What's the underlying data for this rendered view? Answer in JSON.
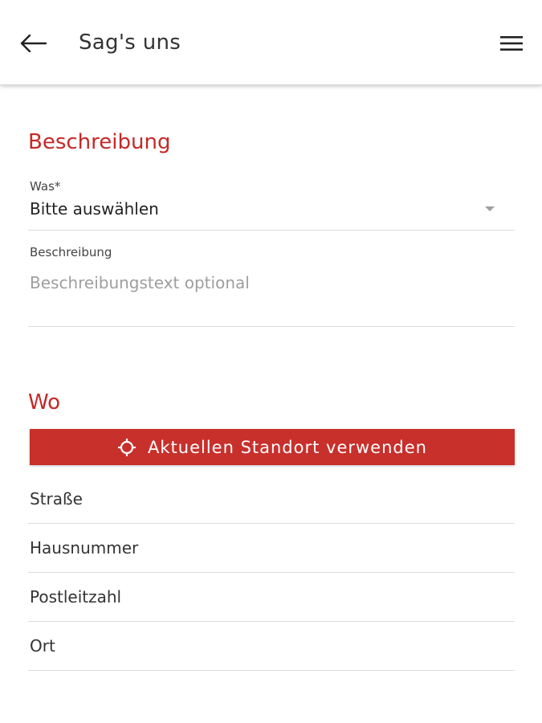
{
  "appbar": {
    "title": "Sag's uns",
    "back_icon": "arrow-left-icon",
    "menu_icon": "hamburger-menu-icon"
  },
  "sections": {
    "beschreibung": {
      "title": "Beschreibung",
      "was_label": "Was*",
      "was_value": "Bitte auswählen",
      "desc_label": "Beschreibung",
      "desc_placeholder": "Beschreibungstext optional"
    },
    "wo": {
      "title": "Wo",
      "location_button": "Aktuellen Standort verwenden",
      "location_icon": "crosshair-icon",
      "fields": {
        "strasse": "Straße",
        "hausnummer": "Hausnummer",
        "postleitzahl": "Postleitzahl",
        "ort": "Ort"
      }
    }
  },
  "colors": {
    "accent": "#c62828",
    "button_bg": "#c8302c",
    "divider": "#dddddd",
    "placeholder": "#9e9e9e"
  }
}
